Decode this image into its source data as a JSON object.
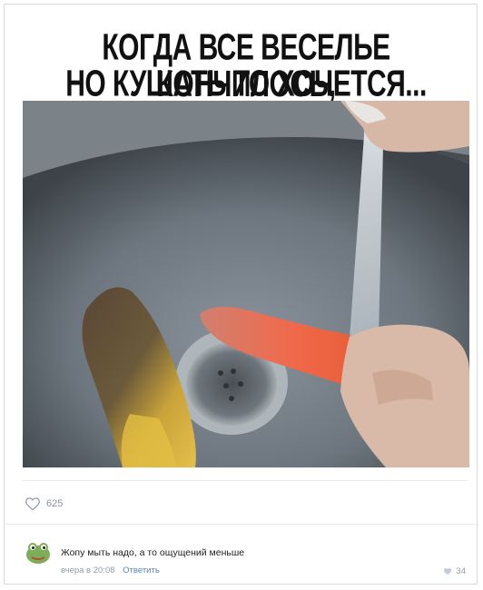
{
  "meme": {
    "caption_line1": "КОГДА ВСЕ ВЕСЕЛЬЕ КОНЧИЛОСЬ,",
    "caption_line2": "НО КУШАТЬ ТО ХОЧЕТСЯ..."
  },
  "post": {
    "likes_count": "625"
  },
  "comment": {
    "text": "Жопу мыть надо, а то ощущений меньше",
    "time": "вчера в 20:08",
    "reply_label": "Ответить",
    "likes_count": "34"
  },
  "colors": {
    "meta_gray": "#929ba5",
    "link_blue": "#5b84b4",
    "divider": "#e7e8ec"
  },
  "icons": [
    "heart-icon",
    "avatar-frog-icon",
    "small-heart-icon"
  ]
}
